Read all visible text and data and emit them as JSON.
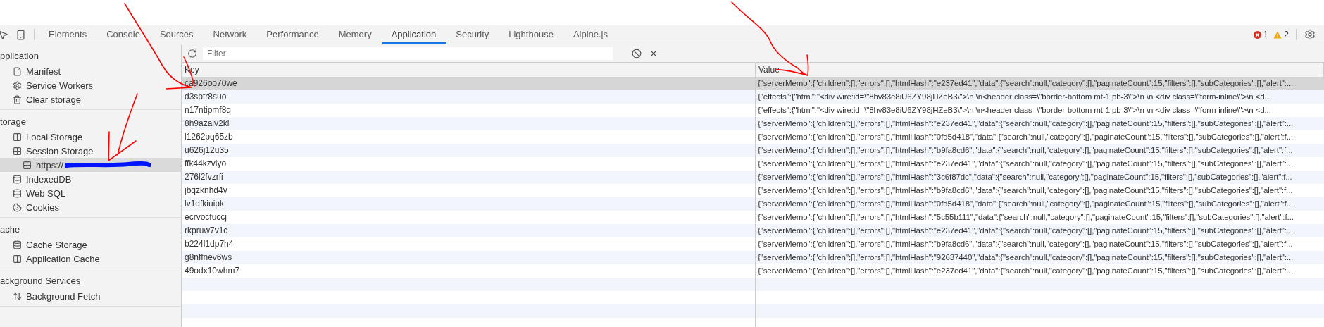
{
  "toolbar": {
    "tabs": [
      {
        "label": "Elements",
        "selected": false
      },
      {
        "label": "Console",
        "selected": false
      },
      {
        "label": "Sources",
        "selected": false
      },
      {
        "label": "Network",
        "selected": false
      },
      {
        "label": "Performance",
        "selected": false
      },
      {
        "label": "Memory",
        "selected": false
      },
      {
        "label": "Application",
        "selected": true
      },
      {
        "label": "Security",
        "selected": false
      },
      {
        "label": "Lighthouse",
        "selected": false
      },
      {
        "label": "Alpine.js",
        "selected": false
      }
    ],
    "errors": "1",
    "warnings": "2"
  },
  "sidebar": {
    "sections": [
      {
        "title": "pplication",
        "items": [
          {
            "label": "Manifest",
            "selected": false
          },
          {
            "label": "Service Workers",
            "selected": false
          },
          {
            "label": "Clear storage",
            "selected": false
          }
        ]
      },
      {
        "title": "torage",
        "items": [
          {
            "label": "Local Storage",
            "selected": false
          },
          {
            "label": "Session Storage",
            "selected": false,
            "expanded": true,
            "children": [
              {
                "label": "https://",
                "selected": true,
                "redacted": true
              }
            ]
          },
          {
            "label": "IndexedDB",
            "selected": false
          },
          {
            "label": "Web SQL",
            "selected": false
          },
          {
            "label": "Cookies",
            "selected": false
          }
        ]
      },
      {
        "title": "ache",
        "items": [
          {
            "label": "Cache Storage",
            "selected": false
          },
          {
            "label": "Application Cache",
            "selected": false
          }
        ]
      },
      {
        "title": "ackground Services",
        "items": [
          {
            "label": "Background Fetch",
            "selected": false
          }
        ]
      }
    ]
  },
  "filter": {
    "placeholder": "Filter"
  },
  "table": {
    "columns": [
      "Key",
      "Value"
    ],
    "rows": [
      {
        "key": "ca926oo70we",
        "value": "{\"serverMemo\":{\"children\":[],\"errors\":[],\"htmlHash\":\"e237ed41\",\"data\":{\"search\":null,\"category\":[],\"paginateCount\":15,\"filters\":[],\"subCategories\":[],\"alert\":...",
        "selected": true
      },
      {
        "key": "d3sptr8suo",
        "value": "{\"effects\":{\"html\":\"<div wire:id=\\\"8hv83e8iU6ZY98jHZeB3\\\">\\n \\n<header class=\\\"border-bottom mt-1 pb-3\\\">\\n \\n <div class=\\\"form-inline\\\">\\n <d...",
        "selected": false
      },
      {
        "key": "n17ntipmf8q",
        "value": "{\"effects\":{\"html\":\"<div wire:id=\\\"8hv83e8iU6ZY98jHZeB3\\\">\\n \\n<header class=\\\"border-bottom mt-1 pb-3\\\">\\n \\n <div class=\\\"form-inline\\\">\\n <d...",
        "selected": false
      },
      {
        "key": "8h9azaiv2kl",
        "value": "{\"serverMemo\":{\"children\":[],\"errors\":[],\"htmlHash\":\"e237ed41\",\"data\":{\"search\":null,\"category\":[],\"paginateCount\":15,\"filters\":[],\"subCategories\":[],\"alert\":...",
        "selected": false
      },
      {
        "key": "l1262pq65zb",
        "value": "{\"serverMemo\":{\"children\":[],\"errors\":[],\"htmlHash\":\"0fd5d418\",\"data\":{\"search\":null,\"category\":[],\"paginateCount\":15,\"filters\":[],\"subCategories\":[],\"alert\":f...",
        "selected": false
      },
      {
        "key": "u626j12u35",
        "value": "{\"serverMemo\":{\"children\":[],\"errors\":[],\"htmlHash\":\"b9fa8cd6\",\"data\":{\"search\":null,\"category\":[],\"paginateCount\":15,\"filters\":[],\"subCategories\":[],\"alert\":f...",
        "selected": false
      },
      {
        "key": "ffk44kzviyo",
        "value": "{\"serverMemo\":{\"children\":[],\"errors\":[],\"htmlHash\":\"e237ed41\",\"data\":{\"search\":null,\"category\":[],\"paginateCount\":15,\"filters\":[],\"subCategories\":[],\"alert\":...",
        "selected": false
      },
      {
        "key": "276l2fvzrfi",
        "value": "{\"serverMemo\":{\"children\":[],\"errors\":[],\"htmlHash\":\"3c6f87dc\",\"data\":{\"search\":null,\"category\":[],\"paginateCount\":15,\"filters\":[],\"subCategories\":[],\"alert\":f...",
        "selected": false
      },
      {
        "key": "jbqzknhd4v",
        "value": "{\"serverMemo\":{\"children\":[],\"errors\":[],\"htmlHash\":\"b9fa8cd6\",\"data\":{\"search\":null,\"category\":[],\"paginateCount\":15,\"filters\":[],\"subCategories\":[],\"alert\":f...",
        "selected": false
      },
      {
        "key": "lv1dfkiuipk",
        "value": "{\"serverMemo\":{\"children\":[],\"errors\":[],\"htmlHash\":\"0fd5d418\",\"data\":{\"search\":null,\"category\":[],\"paginateCount\":15,\"filters\":[],\"subCategories\":[],\"alert\":f...",
        "selected": false
      },
      {
        "key": "ecrvocfuccj",
        "value": "{\"serverMemo\":{\"children\":[],\"errors\":[],\"htmlHash\":\"5c55b111\",\"data\":{\"search\":null,\"category\":[],\"paginateCount\":15,\"filters\":[],\"subCategories\":[],\"alert\":f...",
        "selected": false
      },
      {
        "key": "rkpruw7v1c",
        "value": "{\"serverMemo\":{\"children\":[],\"errors\":[],\"htmlHash\":\"e237ed41\",\"data\":{\"search\":null,\"category\":[],\"paginateCount\":15,\"filters\":[],\"subCategories\":[],\"alert\":...",
        "selected": false
      },
      {
        "key": "b224l1dp7h4",
        "value": "{\"serverMemo\":{\"children\":[],\"errors\":[],\"htmlHash\":\"b9fa8cd6\",\"data\":{\"search\":null,\"category\":[],\"paginateCount\":15,\"filters\":[],\"subCategories\":[],\"alert\":f...",
        "selected": false
      },
      {
        "key": "g8nffnev6ws",
        "value": "{\"serverMemo\":{\"children\":[],\"errors\":[],\"htmlHash\":\"92637440\",\"data\":{\"search\":null,\"category\":[],\"paginateCount\":15,\"filters\":[],\"subCategories\":[],\"alert\":...",
        "selected": false
      },
      {
        "key": "49odx10whm7",
        "value": "{\"serverMemo\":{\"children\":[],\"errors\":[],\"htmlHash\":\"e237ed41\",\"data\":{\"search\":null,\"category\":[],\"paginateCount\":15,\"filters\":[],\"subCategories\":[],\"alert\":...",
        "selected": false
      }
    ]
  }
}
